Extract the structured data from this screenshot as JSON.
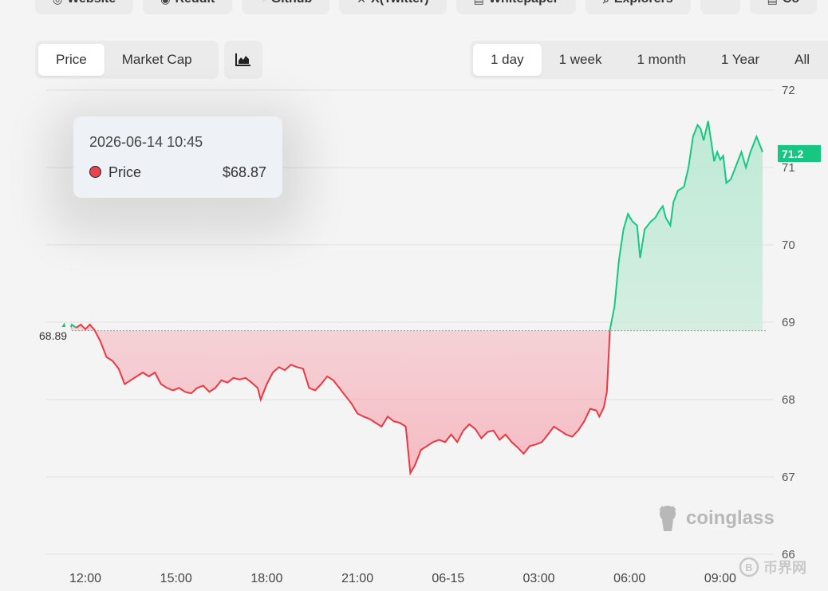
{
  "links": [
    {
      "label": "Website",
      "icon": "globe-icon"
    },
    {
      "label": "Reddit",
      "icon": "reddit-icon"
    },
    {
      "label": "Github",
      "icon": "github-icon"
    },
    {
      "label": "X(Twitter)",
      "icon": "x-icon"
    },
    {
      "label": "Whitepaper",
      "icon": "document-icon"
    },
    {
      "label": "Explorers",
      "icon": "search-icon"
    },
    {
      "label": "",
      "icon": "more-icon"
    },
    {
      "label": "Co",
      "icon": "document-icon"
    }
  ],
  "metric_tabs": [
    {
      "label": "Price",
      "active": true
    },
    {
      "label": "Market Cap",
      "active": false
    }
  ],
  "chart_type_icon": "area-chart-icon",
  "range_tabs": [
    {
      "label": "1 day",
      "active": true
    },
    {
      "label": "1 week",
      "active": false
    },
    {
      "label": "1 month",
      "active": false
    },
    {
      "label": "1 Year",
      "active": false
    },
    {
      "label": "All",
      "active": false
    }
  ],
  "tooltip": {
    "time": "2026-06-14 10:45",
    "series": "Price",
    "value": "$68.87"
  },
  "current_price_label": "71.2",
  "baseline_label": "68.89",
  "watermark": "coinglass",
  "corner_watermark": "币界网",
  "colors": {
    "up": "#16c784",
    "down": "#ea3943",
    "up_fill": "#bfead6",
    "down_fill": "#f5b8c0"
  },
  "chart_data": {
    "type": "area",
    "title": "",
    "baseline": 68.89,
    "current": 71.2,
    "ylim": [
      66,
      72
    ],
    "y_ticks": [
      66,
      67,
      68,
      69,
      70,
      71,
      72
    ],
    "x_ticks": [
      {
        "label": "12:00",
        "h": 12
      },
      {
        "label": "15:00",
        "h": 15
      },
      {
        "label": "18:00",
        "h": 18
      },
      {
        "label": "21:00",
        "h": 21
      },
      {
        "label": "06-15",
        "h": 24
      },
      {
        "label": "03:00",
        "h": 27
      },
      {
        "label": "06:00",
        "h": 30
      },
      {
        "label": "09:00",
        "h": 33
      }
    ],
    "xlim": [
      10.5,
      34.5
    ],
    "series": [
      {
        "values": [
          [
            11.2,
            68.91
          ],
          [
            11.3,
            68.97
          ],
          [
            11.4,
            68.8
          ],
          [
            11.55,
            68.97
          ],
          [
            11.7,
            68.93
          ],
          [
            11.85,
            68.97
          ],
          [
            12.0,
            68.91
          ],
          [
            12.15,
            68.97
          ],
          [
            12.3,
            68.9
          ],
          [
            12.5,
            68.75
          ],
          [
            12.7,
            68.55
          ],
          [
            12.9,
            68.5
          ],
          [
            13.1,
            68.4
          ],
          [
            13.3,
            68.2
          ],
          [
            13.5,
            68.25
          ],
          [
            13.7,
            68.3
          ],
          [
            13.9,
            68.35
          ],
          [
            14.1,
            68.3
          ],
          [
            14.3,
            68.35
          ],
          [
            14.5,
            68.2
          ],
          [
            14.7,
            68.15
          ],
          [
            14.9,
            68.12
          ],
          [
            15.1,
            68.15
          ],
          [
            15.3,
            68.1
          ],
          [
            15.5,
            68.08
          ],
          [
            15.7,
            68.15
          ],
          [
            15.9,
            68.18
          ],
          [
            16.1,
            68.1
          ],
          [
            16.3,
            68.15
          ],
          [
            16.5,
            68.25
          ],
          [
            16.7,
            68.22
          ],
          [
            16.9,
            68.28
          ],
          [
            17.1,
            68.26
          ],
          [
            17.3,
            68.28
          ],
          [
            17.5,
            68.22
          ],
          [
            17.7,
            68.15
          ],
          [
            17.8,
            68.0
          ],
          [
            18.0,
            68.2
          ],
          [
            18.2,
            68.35
          ],
          [
            18.4,
            68.42
          ],
          [
            18.6,
            68.38
          ],
          [
            18.8,
            68.45
          ],
          [
            19.0,
            68.42
          ],
          [
            19.2,
            68.4
          ],
          [
            19.4,
            68.15
          ],
          [
            19.6,
            68.12
          ],
          [
            19.8,
            68.2
          ],
          [
            20.0,
            68.3
          ],
          [
            20.2,
            68.25
          ],
          [
            20.4,
            68.15
          ],
          [
            20.6,
            68.05
          ],
          [
            20.8,
            67.95
          ],
          [
            21.0,
            67.82
          ],
          [
            21.2,
            67.78
          ],
          [
            21.4,
            67.75
          ],
          [
            21.6,
            67.7
          ],
          [
            21.8,
            67.65
          ],
          [
            22.0,
            67.78
          ],
          [
            22.2,
            67.72
          ],
          [
            22.4,
            67.7
          ],
          [
            22.6,
            67.65
          ],
          [
            22.75,
            67.05
          ],
          [
            22.9,
            67.15
          ],
          [
            23.1,
            67.35
          ],
          [
            23.3,
            67.4
          ],
          [
            23.5,
            67.45
          ],
          [
            23.7,
            67.48
          ],
          [
            23.9,
            67.45
          ],
          [
            24.1,
            67.55
          ],
          [
            24.3,
            67.45
          ],
          [
            24.5,
            67.6
          ],
          [
            24.7,
            67.68
          ],
          [
            24.9,
            67.62
          ],
          [
            25.1,
            67.5
          ],
          [
            25.3,
            67.58
          ],
          [
            25.5,
            67.6
          ],
          [
            25.7,
            67.48
          ],
          [
            25.9,
            67.55
          ],
          [
            26.1,
            67.45
          ],
          [
            26.3,
            67.38
          ],
          [
            26.5,
            67.3
          ],
          [
            26.7,
            67.4
          ],
          [
            26.9,
            67.42
          ],
          [
            27.1,
            67.45
          ],
          [
            27.3,
            67.55
          ],
          [
            27.5,
            67.65
          ],
          [
            27.7,
            67.6
          ],
          [
            27.9,
            67.55
          ],
          [
            28.1,
            67.52
          ],
          [
            28.3,
            67.6
          ],
          [
            28.5,
            67.72
          ],
          [
            28.7,
            67.88
          ],
          [
            28.9,
            67.86
          ],
          [
            29.0,
            67.78
          ],
          [
            29.15,
            67.9
          ],
          [
            29.25,
            68.1
          ],
          [
            29.35,
            68.9
          ],
          [
            29.5,
            69.2
          ],
          [
            29.65,
            69.8
          ],
          [
            29.8,
            70.2
          ],
          [
            29.95,
            70.4
          ],
          [
            30.1,
            70.3
          ],
          [
            30.25,
            70.25
          ],
          [
            30.35,
            69.83
          ],
          [
            30.5,
            70.2
          ],
          [
            30.7,
            70.3
          ],
          [
            30.85,
            70.35
          ],
          [
            31.0,
            70.45
          ],
          [
            31.1,
            70.5
          ],
          [
            31.2,
            70.35
          ],
          [
            31.35,
            70.25
          ],
          [
            31.45,
            70.55
          ],
          [
            31.6,
            70.7
          ],
          [
            31.8,
            70.75
          ],
          [
            31.95,
            71.0
          ],
          [
            32.1,
            71.4
          ],
          [
            32.25,
            71.55
          ],
          [
            32.35,
            71.5
          ],
          [
            32.45,
            71.35
          ],
          [
            32.6,
            71.6
          ],
          [
            32.8,
            71.08
          ],
          [
            32.9,
            71.2
          ],
          [
            33.0,
            71.1
          ],
          [
            33.1,
            71.15
          ],
          [
            33.2,
            70.8
          ],
          [
            33.35,
            70.85
          ],
          [
            33.5,
            71.0
          ],
          [
            33.7,
            71.2
          ],
          [
            33.85,
            71.0
          ],
          [
            34.0,
            71.2
          ],
          [
            34.2,
            71.4
          ],
          [
            34.4,
            71.2
          ]
        ]
      }
    ]
  }
}
